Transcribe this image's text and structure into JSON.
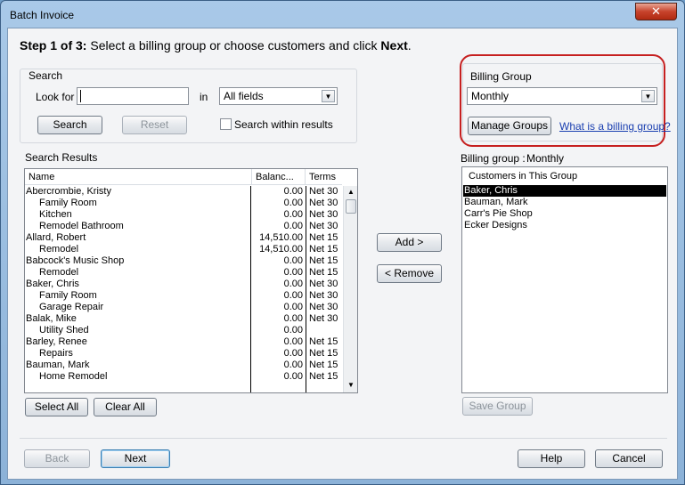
{
  "window": {
    "title": "Batch Invoice",
    "close_glyph": "✕"
  },
  "step": {
    "prefix": "Step 1 of 3:",
    "text": " Select a billing group or choose customers and click ",
    "emphasis": "Next",
    "suffix": "."
  },
  "search": {
    "group_label": "Search",
    "look_for_label": "Look for",
    "look_for_value": "",
    "in_label": "in",
    "field_selected": "All fields",
    "search_button": "Search",
    "reset_button": "Reset",
    "within_results_label": "Search within results"
  },
  "results": {
    "label": "Search Results",
    "columns": [
      "Name",
      "Balanc...",
      "Terms"
    ],
    "rows": [
      {
        "name": "Abercrombie, Kristy",
        "indent": false,
        "balance": "0.00",
        "terms": "Net 30"
      },
      {
        "name": "Family Room",
        "indent": true,
        "balance": "0.00",
        "terms": "Net 30"
      },
      {
        "name": "Kitchen",
        "indent": true,
        "balance": "0.00",
        "terms": "Net 30"
      },
      {
        "name": "Remodel Bathroom",
        "indent": true,
        "balance": "0.00",
        "terms": "Net 30"
      },
      {
        "name": "Allard, Robert",
        "indent": false,
        "balance": "14,510.00",
        "terms": "Net 15"
      },
      {
        "name": "Remodel",
        "indent": true,
        "balance": "14,510.00",
        "terms": "Net 15"
      },
      {
        "name": "Babcock's Music Shop",
        "indent": false,
        "balance": "0.00",
        "terms": "Net 15"
      },
      {
        "name": "Remodel",
        "indent": true,
        "balance": "0.00",
        "terms": "Net 15"
      },
      {
        "name": "Baker, Chris",
        "indent": false,
        "balance": "0.00",
        "terms": "Net 30"
      },
      {
        "name": "Family Room",
        "indent": true,
        "balance": "0.00",
        "terms": "Net 30"
      },
      {
        "name": "Garage Repair",
        "indent": true,
        "balance": "0.00",
        "terms": "Net 30"
      },
      {
        "name": "Balak, Mike",
        "indent": false,
        "balance": "0.00",
        "terms": "Net 30"
      },
      {
        "name": "Utility Shed",
        "indent": true,
        "balance": "0.00",
        "terms": ""
      },
      {
        "name": "Barley, Renee",
        "indent": false,
        "balance": "0.00",
        "terms": "Net 15"
      },
      {
        "name": "Repairs",
        "indent": true,
        "balance": "0.00",
        "terms": "Net 15"
      },
      {
        "name": "Bauman, Mark",
        "indent": false,
        "balance": "0.00",
        "terms": "Net 15"
      },
      {
        "name": "Home Remodel",
        "indent": true,
        "balance": "0.00",
        "terms": "Net 15"
      }
    ],
    "select_all_button": "Select All",
    "clear_all_button": "Clear All"
  },
  "middle": {
    "add_button": "Add >",
    "remove_button": "< Remove"
  },
  "billing": {
    "group_label": "Billing Group",
    "selected": "Monthly",
    "manage_button": "Manage Groups",
    "what_is_link": "What is a billing group?",
    "current_label": "Billing group :",
    "current_value": "Monthly",
    "list_header": "Customers in This Group",
    "customers": [
      "Baker, Chris",
      "Bauman, Mark",
      "Carr's Pie Shop",
      "Ecker Designs"
    ],
    "selected_index": 0,
    "save_button": "Save Group"
  },
  "footer": {
    "back_button": "Back",
    "next_button": "Next",
    "help_button": "Help",
    "cancel_button": "Cancel"
  },
  "colors": {
    "highlight": "#c62020",
    "selection": "#000000",
    "link": "#1a3fb0"
  }
}
